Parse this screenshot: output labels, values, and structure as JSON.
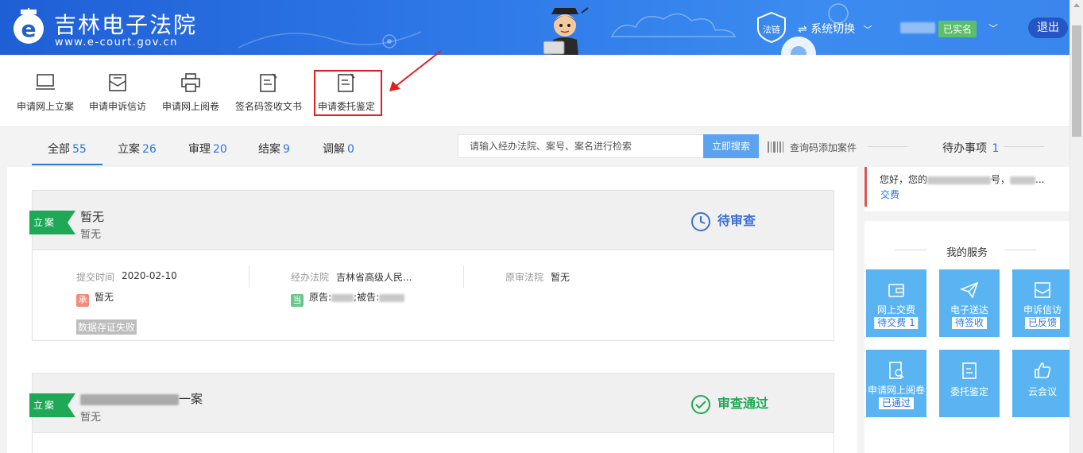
{
  "header": {
    "logo_title": "吉林电子法院",
    "logo_url": "www.e-court.gov.cn",
    "chain_label": "法链",
    "switch_label": "系统切换",
    "verified_badge": "已实名",
    "logout_label": "退出"
  },
  "toolbar": {
    "items": [
      {
        "label": "申请网上立案",
        "icon": "monitor-icon"
      },
      {
        "label": "申请申诉信访",
        "icon": "envelope-icon"
      },
      {
        "label": "申请网上阅卷",
        "icon": "printer-icon"
      },
      {
        "label": "签名码签收文书",
        "icon": "document-sign-icon"
      },
      {
        "label": "申请委托鉴定",
        "icon": "document-edit-icon"
      }
    ],
    "highlighted_item": "申请委托鉴定"
  },
  "tabs": [
    {
      "label": "全部",
      "count": "55"
    },
    {
      "label": "立案",
      "count": "26"
    },
    {
      "label": "审理",
      "count": "20"
    },
    {
      "label": "结案",
      "count": "9"
    },
    {
      "label": "调解",
      "count": "0"
    }
  ],
  "search": {
    "placeholder": "请输入经办法院、案号、案名进行检索",
    "button_label": "立即搜索",
    "qr_link": "查询码添加案件"
  },
  "todo": {
    "title": "待办事项",
    "count": "1",
    "notice_text": "您好，您的",
    "notice_text_mid": "号，",
    "notice_text_end": "...",
    "notice_link": "交费"
  },
  "cases": [
    {
      "ribbon": "立案",
      "title": "暂无",
      "subtitle": "暂无",
      "status": "待审查",
      "status_color": "#3b6fd6",
      "submit_label": "提交时间",
      "submit_value": "2020-02-10",
      "court_label": "经办法院",
      "court_value": "吉林省高级人民...",
      "orig_court_label": "原审法院",
      "orig_court_value": "暂无",
      "handler_badge": "承",
      "handler_value": "暂无",
      "party_badge": "当",
      "plaintiff_label": "原告:",
      "defendant_label": ";被告:",
      "fail_tag": "数据存证失败"
    },
    {
      "ribbon": "立案",
      "title_suffix": "一案",
      "subtitle": "暂无",
      "status": "审查通过",
      "status_color": "#1fa855"
    }
  ],
  "services": {
    "title": "我的服务",
    "tiles": [
      {
        "name": "网上交费",
        "badge": "待交费 1",
        "icon": "wallet-icon"
      },
      {
        "name": "电子送达",
        "badge": "待签收",
        "icon": "paper-plane-icon"
      },
      {
        "name": "申诉信访",
        "badge": "已反馈",
        "icon": "envelope-icon"
      },
      {
        "name": "申请网上阅卷",
        "badge": "已通过",
        "icon": "file-search-icon"
      },
      {
        "name": "委托鉴定",
        "badge": "",
        "icon": "document-edit-icon"
      },
      {
        "name": "云会议",
        "badge": "",
        "icon": "thumbs-up-icon"
      }
    ]
  }
}
